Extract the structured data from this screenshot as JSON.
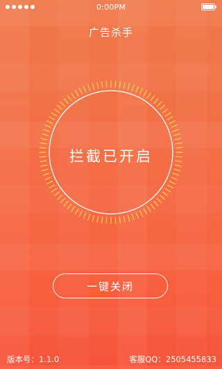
{
  "status_bar": {
    "time": "0:00PM",
    "signal_icon": "signal-dots-icon",
    "battery_icon": "battery-icon"
  },
  "app": {
    "title": "广告杀手"
  },
  "blocker": {
    "status_text": "拦截已开启",
    "ring_icon": "tick-ring-icon"
  },
  "action": {
    "button_label": "一键关闭"
  },
  "footer": {
    "version_text": "版本号：1.1.0",
    "service_qq_text": "客服QQ：2505455833"
  },
  "colors": {
    "background_top": "#f0794a",
    "background_bottom": "#f6553a",
    "ring_ticks": "#fcd34d",
    "foreground": "#ffffff"
  }
}
